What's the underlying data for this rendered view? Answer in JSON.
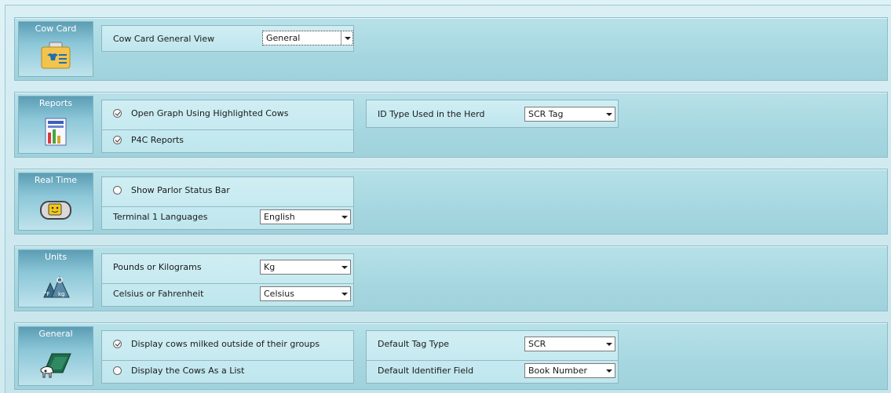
{
  "sections": {
    "cow_card": {
      "title": "Cow Card",
      "icon": "cow-card-icon",
      "rows": {
        "general_view": {
          "label": "Cow Card General View",
          "value": "General"
        }
      }
    },
    "reports": {
      "title": "Reports",
      "icon": "report-chart-icon",
      "rows": {
        "open_graph": {
          "label": "Open Graph Using Highlighted Cows",
          "checked": true
        },
        "p4c": {
          "label": "P4C Reports",
          "checked": true
        },
        "id_type": {
          "label": "ID Type Used in the Herd",
          "value": "SCR Tag"
        }
      }
    },
    "real_time": {
      "title": "Real Time",
      "icon": "terminal-icon",
      "rows": {
        "parlor_status": {
          "label": "Show Parlor Status Bar",
          "checked": false
        },
        "terminal_lang": {
          "label": "Terminal 1 Languages",
          "value": "English"
        }
      }
    },
    "units": {
      "title": "Units",
      "icon": "units-weights-icon",
      "rows": {
        "weight": {
          "label": "Pounds or Kilograms",
          "value": "Kg"
        },
        "temperature": {
          "label": "Celsius or Fahrenheit",
          "value": "Celsius"
        }
      }
    },
    "general": {
      "title": "General",
      "icon": "cow-general-icon",
      "rows": {
        "outside_groups": {
          "label": "Display cows milked outside of their groups",
          "checked": true
        },
        "as_list": {
          "label": "Display the Cows As a List",
          "checked": false
        },
        "tag_type": {
          "label": "Default Tag Type",
          "value": "SCR"
        },
        "identifier": {
          "label": "Default Identifier Field",
          "value": "Book Number"
        }
      }
    }
  },
  "colors": {
    "section_bg": "#a6d7e0",
    "header_bg": "#5c9db4",
    "panel_bg": "#cfeef3"
  }
}
